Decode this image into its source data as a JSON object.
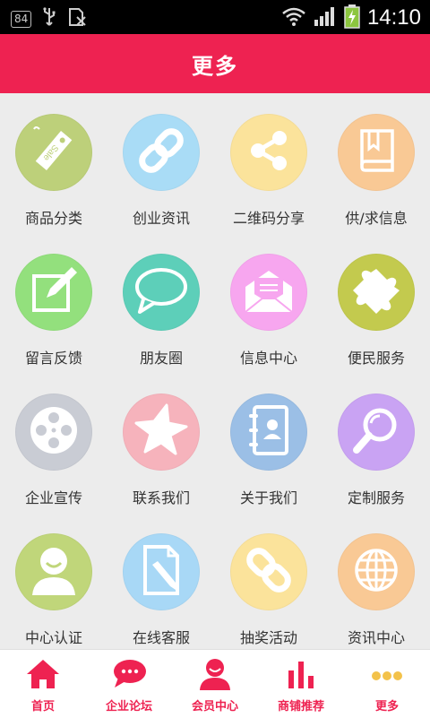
{
  "status_bar": {
    "badge": "84",
    "time": "14:10"
  },
  "header": {
    "title": "更多"
  },
  "colors": {
    "accent": "#ee2251"
  },
  "grid": [
    {
      "label": "商品分类",
      "icon": "sale-tag-icon",
      "color": "#bdd07a"
    },
    {
      "label": "创业资讯",
      "icon": "chain-link-icon",
      "color": "#a9dcf6"
    },
    {
      "label": "二维码分享",
      "icon": "share-icon",
      "color": "#fbe39b"
    },
    {
      "label": "供/求信息",
      "icon": "book-icon",
      "color": "#f9c995"
    },
    {
      "label": "留言反馈",
      "icon": "edit-note-icon",
      "color": "#93e07d"
    },
    {
      "label": "朋友圈",
      "icon": "chat-bubble-icon",
      "color": "#5dcfb9"
    },
    {
      "label": "信息中心",
      "icon": "mail-icon",
      "color": "#f7a6ef"
    },
    {
      "label": "便民服务",
      "icon": "puzzle-icon",
      "color": "#c3ca4e"
    },
    {
      "label": "企业宣传",
      "icon": "film-reel-icon",
      "color": "#c9ccd4"
    },
    {
      "label": "联系我们",
      "icon": "star-icon",
      "color": "#f6b3bc"
    },
    {
      "label": "关于我们",
      "icon": "contacts-book-icon",
      "color": "#9bbfe6"
    },
    {
      "label": "定制服务",
      "icon": "magnifier-icon",
      "color": "#c9a3f3"
    },
    {
      "label": "中心认证",
      "icon": "user-avatar-icon",
      "color": "#c0d67a"
    },
    {
      "label": "在线客服",
      "icon": "document-pencil-icon",
      "color": "#a8d8f6"
    },
    {
      "label": "抽奖活动",
      "icon": "chain-link-icon",
      "color": "#fbe39b"
    },
    {
      "label": "资讯中心",
      "icon": "globe-icon",
      "color": "#f9c995"
    }
  ],
  "bottom_nav": [
    {
      "label": "首页",
      "icon": "home-icon"
    },
    {
      "label": "企业论坛",
      "icon": "forum-bubble-icon"
    },
    {
      "label": "会员中心",
      "icon": "member-icon"
    },
    {
      "label": "商铺推荐",
      "icon": "bar-chart-icon"
    },
    {
      "label": "更多",
      "icon": "more-dots-icon"
    }
  ]
}
